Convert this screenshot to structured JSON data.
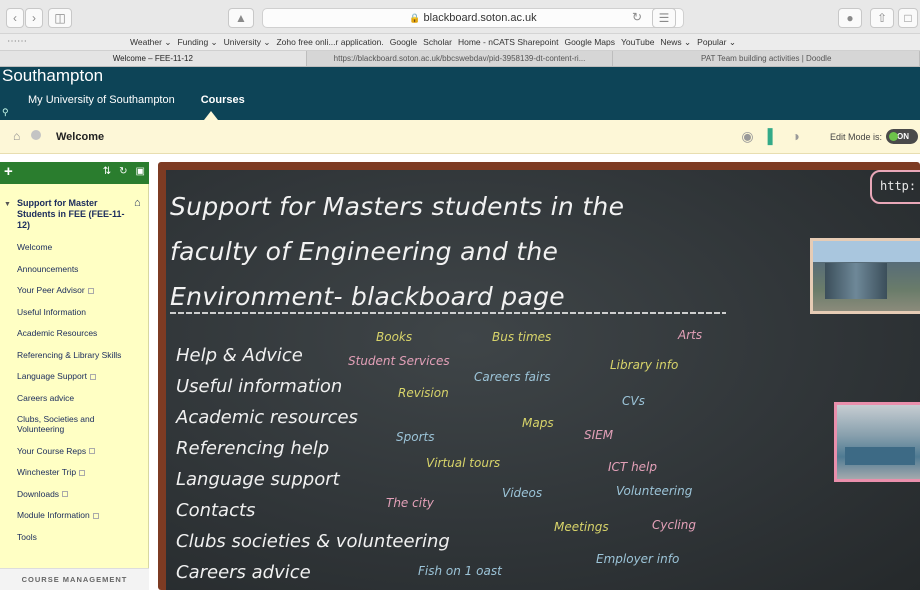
{
  "browser": {
    "url": "blackboard.soton.ac.uk",
    "favorites": [
      "Weather ⌄",
      "Funding ⌄",
      "University ⌄",
      "Zoho free onli...r application.",
      "Google",
      "Scholar",
      "Home - nCATS Sharepoint",
      "Google Maps",
      "YouTube",
      "News ⌄",
      "Popular ⌄"
    ],
    "tabs": [
      "Welcome – FEE-11-12",
      "https://blackboard.soton.ac.uk/bbcswebdav/pid-3958139-dt-content-ri...",
      "PAT Team building activities | Doodle"
    ]
  },
  "header": {
    "brand": "Southampton",
    "nav": [
      "My University of Southampton",
      "Courses"
    ]
  },
  "breadcrumb": {
    "title": "Welcome",
    "edit_mode_label": "Edit Mode is:",
    "edit_mode_value": "ON"
  },
  "menu": {
    "course_title": "Support for Master Students in FEE (FEE-11-12)",
    "items": [
      {
        "label": "Welcome",
        "ext": false
      },
      {
        "label": "Announcements",
        "ext": false
      },
      {
        "label": "Your Peer Advisor",
        "ext": true
      },
      {
        "label": "Useful Information",
        "ext": false
      },
      {
        "label": "Academic Resources",
        "ext": false
      },
      {
        "label": "Referencing & Library Skills",
        "ext": false
      },
      {
        "label": "Language Support",
        "ext": true
      },
      {
        "label": "Careers advice",
        "ext": false
      },
      {
        "label": "Clubs, Societies and Volunteering",
        "ext": false
      },
      {
        "label": "Your Course Reps",
        "ext": true
      },
      {
        "label": "Winchester Trip",
        "ext": true
      },
      {
        "label": "Downloads",
        "ext": true
      },
      {
        "label": "Module Information",
        "ext": true
      },
      {
        "label": "Tools",
        "ext": false
      }
    ],
    "course_management": "COURSE MANAGEMENT"
  },
  "board": {
    "title_lines": [
      "Support for Masters students in the",
      "faculty of Engineering and the",
      "Environment- blackboard page"
    ],
    "http_label": "http:",
    "links": [
      "Help & Advice",
      "Useful information",
      "Academic resources",
      "Referencing help",
      "Language support",
      "Contacts",
      "Clubs societies & volunteering",
      "Careers advice"
    ],
    "tags": [
      {
        "text": "Books",
        "color": "#d8d46a"
      },
      {
        "text": "Bus times",
        "color": "#d8d46a"
      },
      {
        "text": "Arts",
        "color": "#e3a0b8"
      },
      {
        "text": "Student Services",
        "color": "#e3a0b8"
      },
      {
        "text": "Careers fairs",
        "color": "#9cc4d8"
      },
      {
        "text": "Library info",
        "color": "#d8d46a"
      },
      {
        "text": "Revision",
        "color": "#d8d46a"
      },
      {
        "text": "CVs",
        "color": "#9cc4d8"
      },
      {
        "text": "Maps",
        "color": "#d8d46a"
      },
      {
        "text": "Sports",
        "color": "#9cc4d8"
      },
      {
        "text": "SIEM",
        "color": "#e3a0b8"
      },
      {
        "text": "Virtual tours",
        "color": "#d8d46a"
      },
      {
        "text": "ICT help",
        "color": "#e3a0b8"
      },
      {
        "text": "Videos",
        "color": "#9cc4d8"
      },
      {
        "text": "Volunteering",
        "color": "#9cc4d8"
      },
      {
        "text": "The city",
        "color": "#e3a0b8"
      },
      {
        "text": "Meetings",
        "color": "#d8d46a"
      },
      {
        "text": "Cycling",
        "color": "#e3a0b8"
      },
      {
        "text": "Employer info",
        "color": "#9cc4d8"
      },
      {
        "text": "Fish on 1 oast",
        "color": "#9cc4d8"
      }
    ]
  }
}
